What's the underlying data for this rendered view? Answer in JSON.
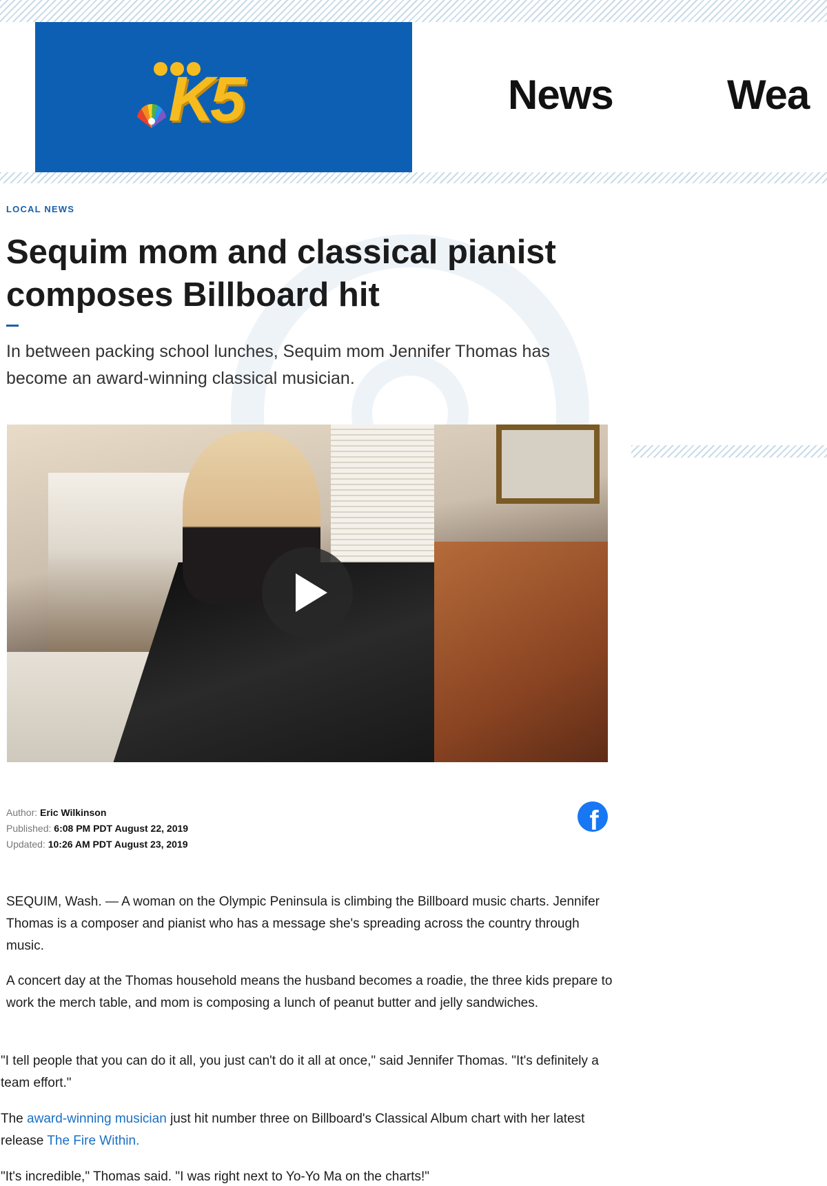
{
  "header": {
    "logo_text": "K5",
    "nav": [
      "News",
      "Wea"
    ]
  },
  "article": {
    "category": "LOCAL NEWS",
    "headline": "Sequim mom and classical pianist composes Billboard hit",
    "summary": "In between packing school lunches, Sequim mom Jennifer Thomas has become an award-winning classical musician.",
    "meta": {
      "author_label": "Author:",
      "author": "Eric Wilkinson",
      "published_label": "Published:",
      "published": "6:08 PM PDT August 22, 2019",
      "updated_label": "Updated:",
      "updated": "10:26 AM PDT August 23, 2019"
    },
    "share_facebook": "f",
    "paragraphs": {
      "p1": "SEQUIM, Wash. — A woman on the Olympic Peninsula is climbing the Billboard music charts. Jennifer Thomas is a composer and pianist who has a message she's spreading across the country through music.",
      "p2": "A concert day at the Thomas household means the husband becomes a roadie, the three kids prepare to work the merch table, and mom is composing a lunch of peanut butter and jelly sandwiches.",
      "p3": "\"I tell people that you can do it all, you just can't do it all at once,\" said Jennifer Thomas. \"It's definitely a team effort.\"",
      "p4_a": "The ",
      "p4_link1": "award-winning musician",
      "p4_b": " just hit number three on Billboard's Classical Album chart with her latest release ",
      "p4_link2": "The Fire Within.",
      "p5": "\"It's incredible,\" Thomas said. \"I was right next to Yo-Yo Ma on the charts!\""
    }
  },
  "colors": {
    "brand_blue": "#0d5fb3",
    "logo_gold": "#f6bc1f",
    "link": "#1a6fc4",
    "facebook": "#1877f2"
  },
  "icons": [
    "nbc-peacock-icon",
    "play-icon",
    "facebook-icon"
  ]
}
